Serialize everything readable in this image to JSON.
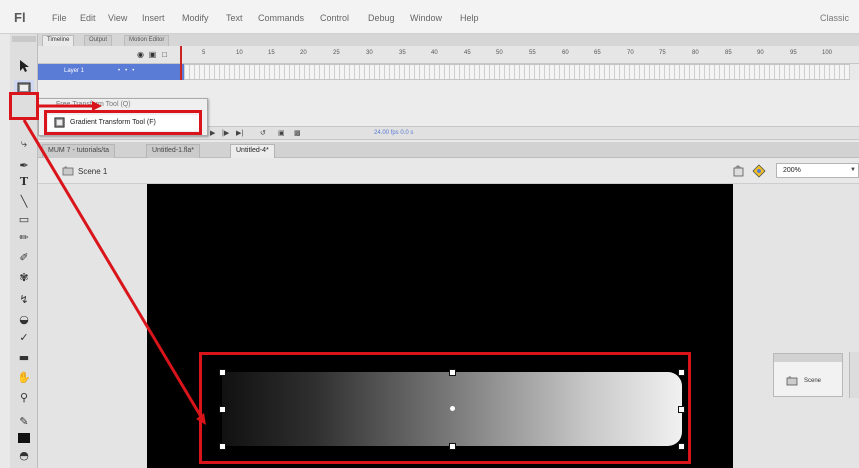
{
  "app": {
    "logo": "Fl",
    "workspace": "Classic"
  },
  "menu": [
    "File",
    "Edit",
    "View",
    "Insert",
    "Modify",
    "Text",
    "Commands",
    "Control",
    "Debug",
    "Window",
    "Help"
  ],
  "timeline": {
    "tabs": [
      "Timeline",
      "Output",
      "Motion Editor"
    ],
    "layer_name": "Layer 1",
    "frame_numbers": [
      "5",
      "10",
      "15",
      "20",
      "25",
      "30",
      "35",
      "40",
      "45",
      "50",
      "55",
      "60",
      "65",
      "70",
      "75",
      "80",
      "85",
      "90",
      "95",
      "100"
    ],
    "fps": "24.00 fps  0.0 s"
  },
  "flyout": {
    "ghost_label": "Free Transform Tool (Q)",
    "item_label": "Gradient Transform Tool (F)"
  },
  "documents": {
    "tabs": [
      "MUM 7 - tutorials/ta",
      "Untitled-1.fla*",
      "Untitled-4*"
    ],
    "active_index": 2
  },
  "edit_bar": {
    "scene": "Scene 1",
    "zoom": "200%"
  },
  "scene_panel": {
    "label": "Scene"
  },
  "colors": {
    "annotation": "#d9141b",
    "layer_highlight": "#5a7bd6",
    "stage": "#000000"
  },
  "icons": [
    "selection-arrow-icon",
    "gradient-transform-icon",
    "text-tool-icon",
    "line-tool-icon",
    "rectangle-tool-icon",
    "pencil-tool-icon",
    "brush-tool-icon",
    "paint-bucket-icon",
    "eyedropper-icon",
    "eraser-icon",
    "hand-tool-icon",
    "zoom-tool-icon",
    "stroke-color-icon",
    "fill-color-icon"
  ]
}
